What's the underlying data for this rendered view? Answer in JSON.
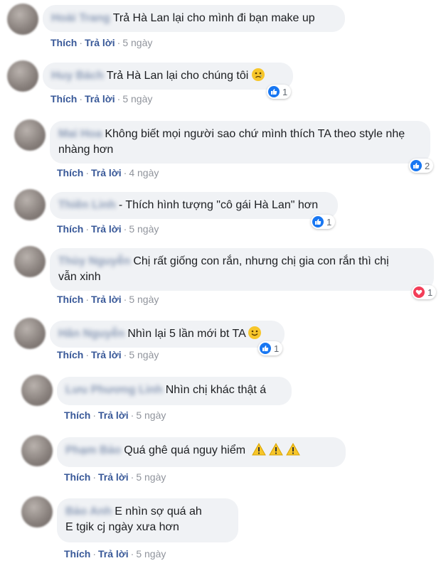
{
  "action_like": "Thích",
  "action_reply": "Trả lời",
  "separator": "·",
  "colors": {
    "link": "#385898",
    "bubble": "#f0f2f5",
    "like": "#1877f2",
    "love": "#f33e58"
  },
  "comments": [
    {
      "name": "Hoài Trang",
      "text": "Trả Hà Lan lại cho mình đi bạn make up",
      "time": "5 ngày"
    },
    {
      "name": "Huy Bách",
      "text": "Trả Hà Lan lại cho chúng tôi",
      "emoji": "crying-face",
      "time": "5 ngày",
      "reaction": {
        "type": "like",
        "count": "1"
      }
    },
    {
      "name": "Mai Hoa",
      "text_line1": "Không biết mọi người sao chứ mình thích TA theo style nhẹ",
      "text_line2": "nhàng hơn",
      "time": "4 ngày",
      "reaction": {
        "type": "like",
        "count": "2"
      }
    },
    {
      "name": "Thiên Linh",
      "text": "- Thích hình tượng \"cô gái Hà Lan\" hơn",
      "time": "5 ngày",
      "reaction": {
        "type": "like",
        "count": "1"
      }
    },
    {
      "name": "Thùy Nguyễn",
      "text_line1": "Chị rất giống con rắn, nhưng chị gia con rắn thì chị",
      "text_line2": "vẫn xinh",
      "time": "5 ngày",
      "reaction": {
        "type": "love",
        "count": "1"
      }
    },
    {
      "name": "Hân Nguyễn",
      "text": "Nhìn lại 5 lần mới bt TA",
      "emoji": "smiling-face",
      "time": "5 ngày",
      "reaction": {
        "type": "like",
        "count": "1"
      }
    },
    {
      "name": "Lưu Phương Linh",
      "text": "Nhìn chị khác thật á",
      "time": "5 ngày"
    },
    {
      "name": "Phạm Bảo",
      "text": "Quá ghê quá nguy hiểm",
      "emoji": "warning-sign",
      "time": "5 ngày"
    },
    {
      "name": "Bảo Anh",
      "text_line1": "E nhìn sợ quá ah",
      "text_line2": "E tgik cj ngày xưa hơn",
      "time": "5 ngày"
    }
  ]
}
